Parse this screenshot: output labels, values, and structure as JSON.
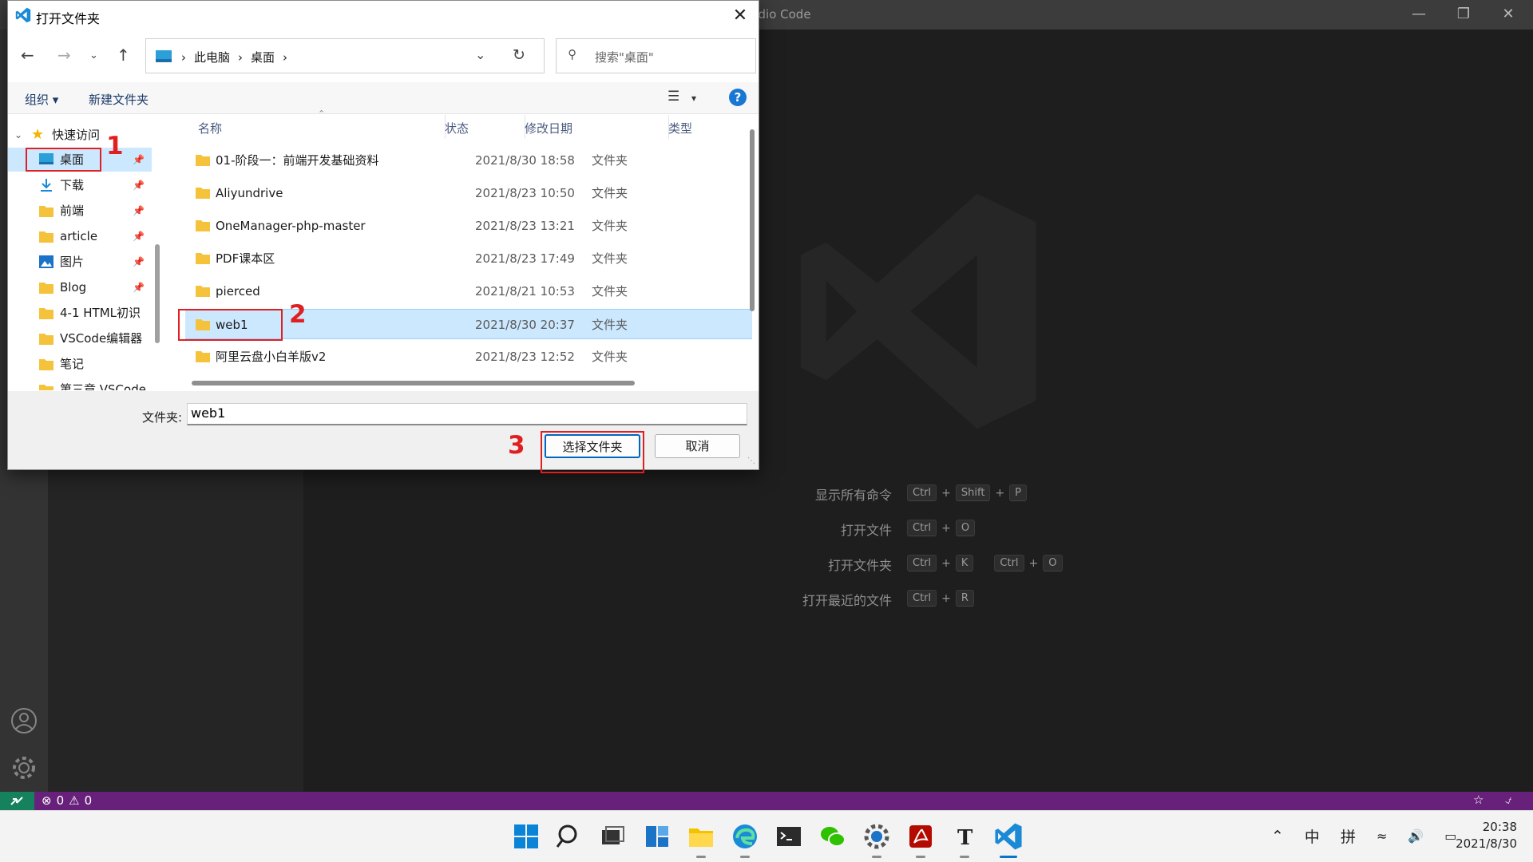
{
  "vscode": {
    "title_visible": "udio Code",
    "welcome_shortcuts": [
      {
        "label": "显示所有命令",
        "keys": [
          "Ctrl",
          "+",
          "Shift",
          "+",
          "P"
        ]
      },
      {
        "label": "打开文件",
        "keys": [
          "Ctrl",
          "+",
          "O"
        ]
      },
      {
        "label": "打开文件夹",
        "keys": [
          "Ctrl",
          "+",
          "K",
          "Ctrl",
          "+",
          "O"
        ]
      },
      {
        "label": "打开最近的文件",
        "keys": [
          "Ctrl",
          "+",
          "R"
        ]
      }
    ]
  },
  "statusbar": {
    "errors": "0",
    "warnings": "0"
  },
  "dialog": {
    "title": "打开文件夹",
    "address": {
      "crumbs": [
        "此电脑",
        "桌面"
      ]
    },
    "search_placeholder": "搜索\"桌面\"",
    "toolbar": {
      "organize": "组织",
      "new_folder": "新建文件夹"
    },
    "nav": {
      "quick_access": "快速访问",
      "items": [
        {
          "label": "桌面",
          "icon": "desktop-icon",
          "pinned": true
        },
        {
          "label": "下载",
          "icon": "download-icon",
          "pinned": true
        },
        {
          "label": "前端",
          "icon": "folder-icon",
          "pinned": true
        },
        {
          "label": "article",
          "icon": "folder-icon",
          "pinned": true
        },
        {
          "label": "图片",
          "icon": "pictures-icon",
          "pinned": true
        },
        {
          "label": "Blog",
          "icon": "folder-icon",
          "pinned": true
        },
        {
          "label": "4-1 HTML初识",
          "icon": "folder-icon",
          "pinned": false
        },
        {
          "label": "VSCode编辑器",
          "icon": "folder-icon",
          "pinned": false
        },
        {
          "label": "笔记",
          "icon": "folder-icon",
          "pinned": false
        },
        {
          "label": "第三章 VSCode",
          "icon": "folder-icon",
          "pinned": false
        }
      ]
    },
    "columns": {
      "name": "名称",
      "status": "状态",
      "modified": "修改日期",
      "type": "类型"
    },
    "files": [
      {
        "name": "01-阶段一：前端开发基础资料",
        "date": "2021/8/30 18:58",
        "type": "文件夹"
      },
      {
        "name": "Aliyundrive",
        "date": "2021/8/23 10:50",
        "type": "文件夹"
      },
      {
        "name": "OneManager-php-master",
        "date": "2021/8/23 13:21",
        "type": "文件夹"
      },
      {
        "name": "PDF课本区",
        "date": "2021/8/23 17:49",
        "type": "文件夹"
      },
      {
        "name": "pierced",
        "date": "2021/8/21 10:53",
        "type": "文件夹"
      },
      {
        "name": "web1",
        "date": "2021/8/30 20:37",
        "type": "文件夹",
        "selected": true
      },
      {
        "name": "阿里云盘小白羊版v2",
        "date": "2021/8/23 12:52",
        "type": "文件夹"
      }
    ],
    "folder_label": "文件夹:",
    "folder_value": "web1",
    "select_button": "选择文件夹",
    "cancel_button": "取消"
  },
  "annotations": [
    "1",
    "2",
    "3"
  ],
  "clock": {
    "time": "20:38",
    "date": "2021/8/30"
  },
  "tray": {
    "ime_lang": "中",
    "ime_mode": "拼"
  },
  "colors": {
    "statusbar": "#68217a",
    "selection": "#cce8ff",
    "annotation": "#e02020",
    "accent": "#0067c0"
  }
}
